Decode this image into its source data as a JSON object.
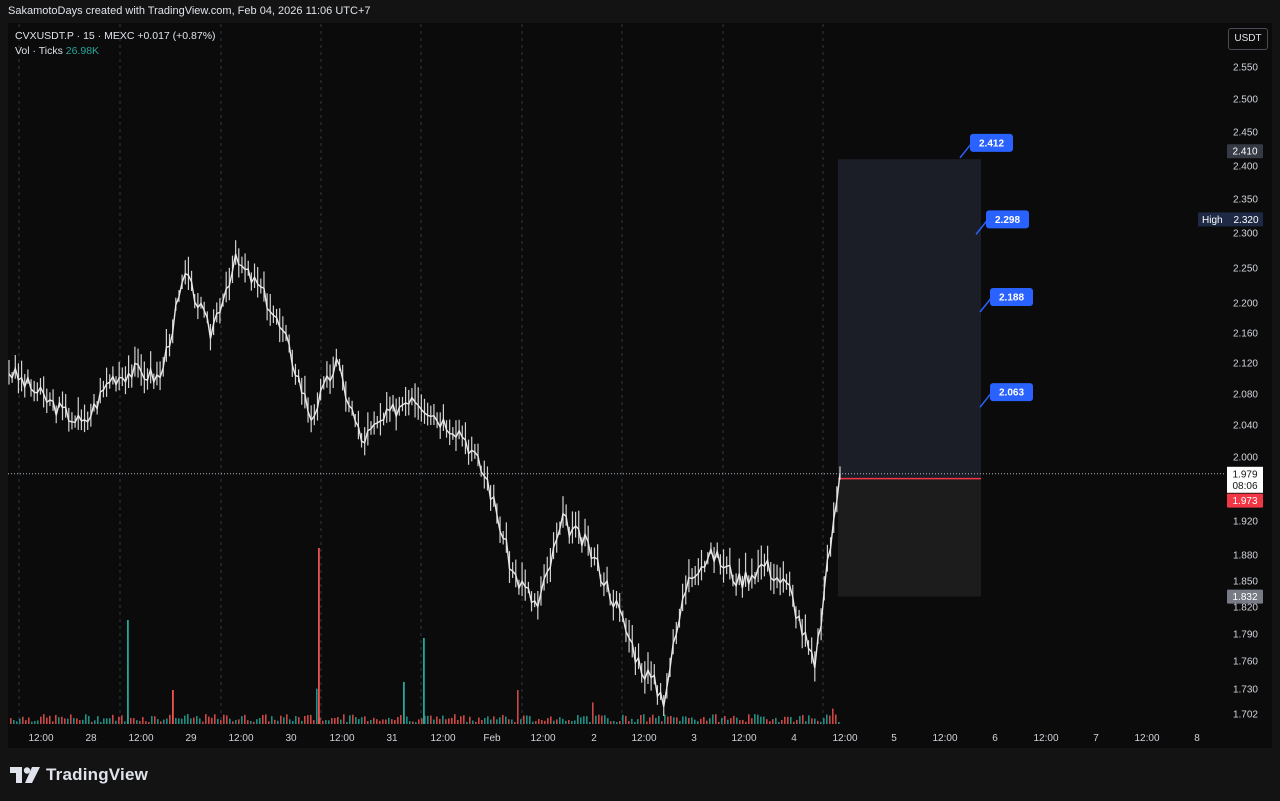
{
  "header": {
    "text": "SakamotoDays created with TradingView.com, Feb 04, 2026 11:06 UTC+7"
  },
  "legend": {
    "symbol_line": "CVXUSDT.P · 15 · MEXC  +0.017 (+0.87%)",
    "vol_label": "Vol · Ticks",
    "vol_value": "26.98K"
  },
  "currency": "USDT",
  "footer": {
    "brand": "TradingView"
  },
  "colors": {
    "background": "#0b0b0b",
    "candle": "#e8e8e8",
    "vol_up": "#26a69a",
    "vol_down": "#ef5350",
    "target_label": "#2962ff",
    "current_price": "#ffffff",
    "entry_line": "#f23645"
  },
  "chart_data": {
    "type": "line",
    "symbol": "CVXUSDT.P",
    "interval": "15",
    "exchange": "MEXC",
    "y_axis": {
      "ticks": [
        "2.550",
        "2.500",
        "2.450",
        "2.400",
        "2.350",
        "2.300",
        "2.250",
        "2.200",
        "2.160",
        "2.120",
        "2.080",
        "2.040",
        "2.000",
        "1.960",
        "1.920",
        "1.880",
        "1.850",
        "1.820",
        "1.790",
        "1.760",
        "1.730",
        "1.702"
      ]
    },
    "x_axis": {
      "ticks": [
        "12:00",
        "28",
        "12:00",
        "29",
        "12:00",
        "30",
        "12:00",
        "31",
        "12:00",
        "Feb",
        "12:00",
        "2",
        "12:00",
        "3",
        "12:00",
        "4",
        "12:00",
        "5",
        "12:00",
        "6",
        "12:00",
        "7",
        "12:00",
        "8"
      ]
    },
    "series": [
      {
        "x": [
          "27 06:00",
          "27 12:00",
          "27 18:00",
          "28 00:00",
          "28 06:00",
          "28 12:00",
          "28 18:00",
          "29 00:00",
          "29 06:00",
          "29 12:00",
          "29 18:00",
          "30 00:00",
          "30 06:00",
          "30 12:00",
          "30 18:00",
          "31 00:00",
          "31 06:00",
          "31 12:00",
          "31 18:00",
          "Feb 1 00:00",
          "Feb 1 06:00",
          "Feb 1 12:00",
          "Feb 1 18:00",
          "2 00:00",
          "2 06:00",
          "2 12:00",
          "2 18:00",
          "3 00:00",
          "3 06:00",
          "3 12:00",
          "3 18:00",
          "4 00:00",
          "4 06:00",
          "4 11:00"
        ],
        "values": [
          2.11,
          2.085,
          2.06,
          2.04,
          2.1,
          2.11,
          2.1,
          2.24,
          2.16,
          2.26,
          2.22,
          2.15,
          2.05,
          2.12,
          2.02,
          2.05,
          2.08,
          2.05,
          2.03,
          1.97,
          1.86,
          1.82,
          1.92,
          1.89,
          1.83,
          1.76,
          1.72,
          1.86,
          1.88,
          1.85,
          1.87,
          1.84,
          1.75,
          1.979
        ]
      }
    ],
    "volume": {
      "label": "Vol · Ticks",
      "last": "26.98K"
    },
    "price_labels": {
      "target_box_top": "2.410",
      "high_label": "High",
      "high_value": "2.320",
      "current": "1.979",
      "countdown": "08:06",
      "entry": "1.973",
      "stop": "1.832"
    },
    "targets": [
      "2.412",
      "2.298",
      "2.188",
      "2.063"
    ]
  }
}
